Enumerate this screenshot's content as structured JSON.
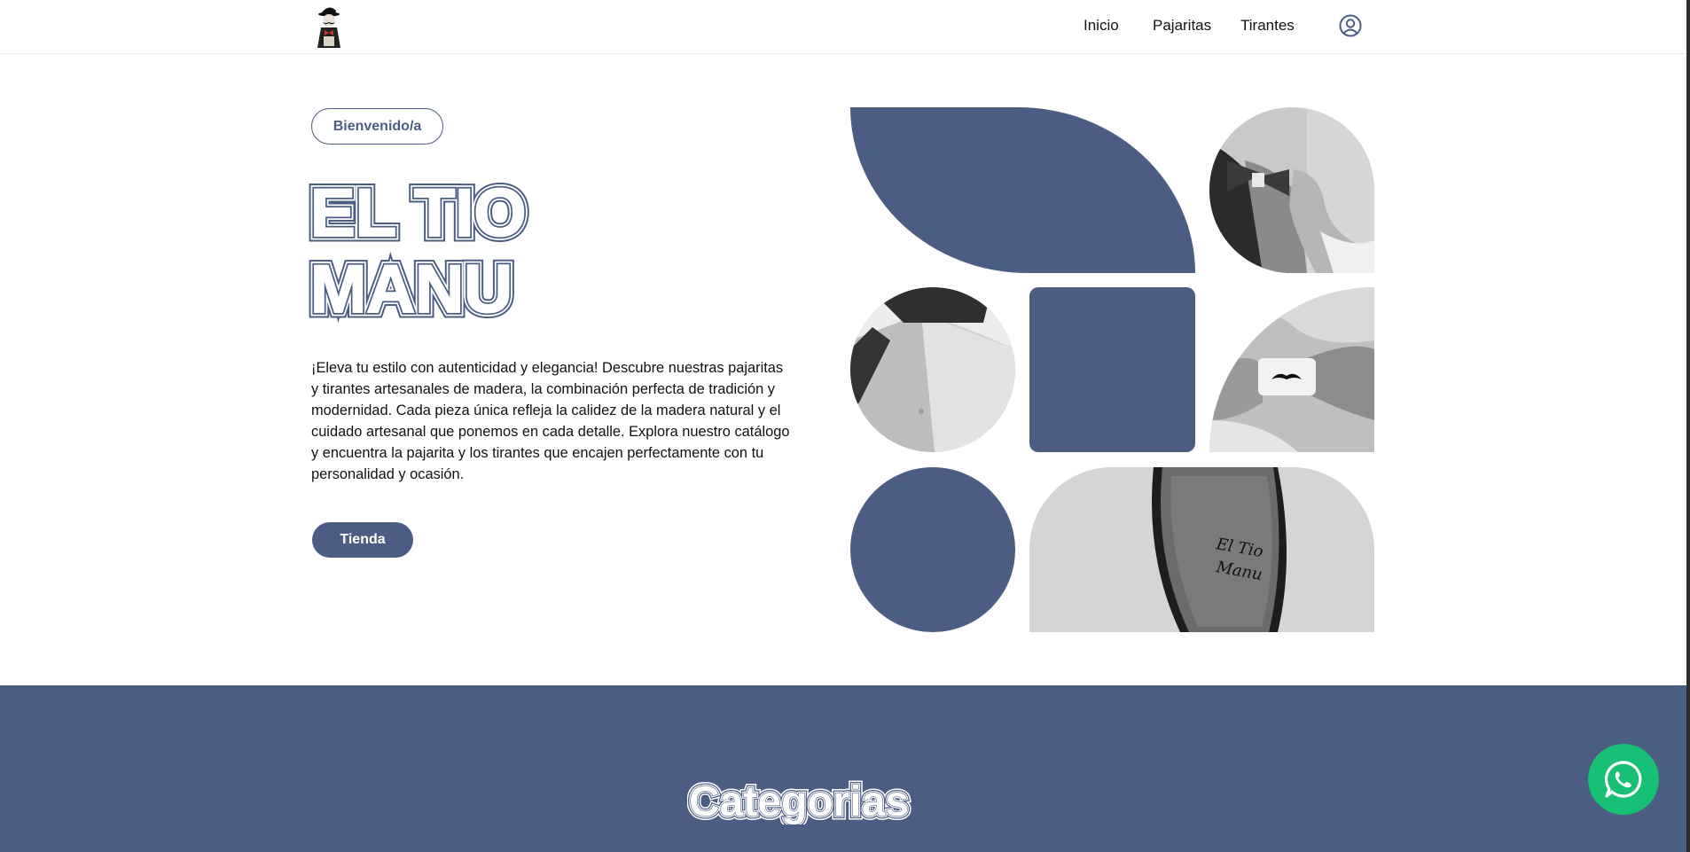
{
  "header": {
    "logo_icon": "mustache-man-logo-icon",
    "nav": {
      "inicio": "Inicio",
      "pajaritas": "Pajaritas",
      "tirantes": "Tirantes"
    },
    "user_icon": "user-circle-icon"
  },
  "hero": {
    "badge": "Bienvenido/a",
    "title_line1": "EL TIO",
    "title_line2": "MANU",
    "description": "¡Eleva tu estilo con autenticidad y elegancia! Descubre nuestras pajaritas y tirantes artesanales de madera, la combinación perfecta de tradición y modernidad. Cada pieza única refleja la calidez de la madera natural y el cuidado artesanal que ponemos en cada detalle. Explora nuestro catálogo y encuentra la pajarita y los tirantes que encajen perfectamente con tu personalidad y ocasión.",
    "cta": "Tienda",
    "engraving_line1": "El Tio",
    "engraving_line2": "Manu"
  },
  "categories": {
    "title": "Categorias"
  },
  "colors": {
    "brand": "#4c5d83",
    "whatsapp": "#17c074",
    "white": "#ffffff"
  },
  "floating": {
    "whatsapp_icon": "whatsapp-icon"
  }
}
